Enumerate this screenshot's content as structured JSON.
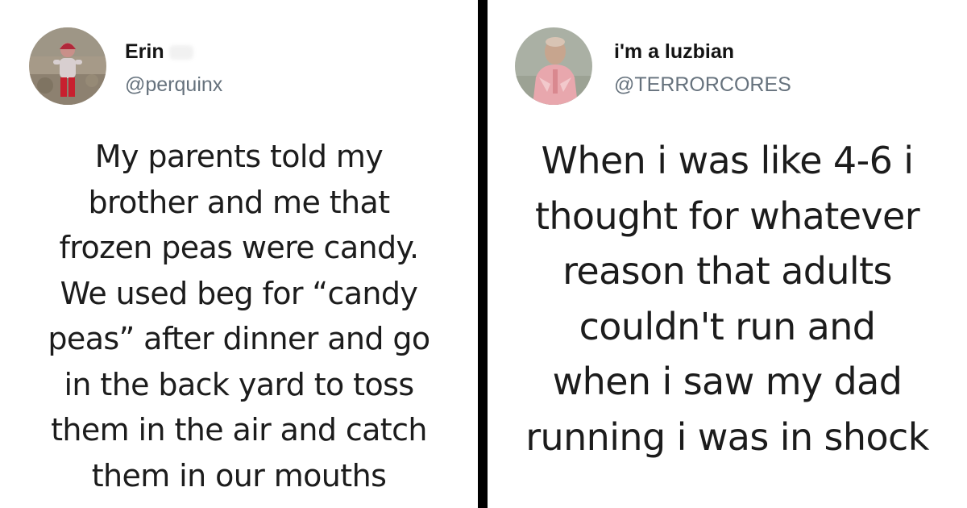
{
  "colors": {
    "divider": "#000000",
    "background": "#ffffff",
    "handle": "#66727d",
    "text": "#1c1c1c"
  },
  "left_tweet": {
    "display_name": "Erin",
    "handle": "@perquinx",
    "avatar_icon": "profile-photo-child-in-red",
    "text": "My parents told my\nbrother and me that\nfrozen peas were candy.\nWe used beg for “candy\npeas” after dinner and go\nin the back yard to toss\nthem in the air and catch\nthem in our mouths"
  },
  "right_tweet": {
    "display_name": "i'm a luzbian",
    "handle": "@TERRORCORES",
    "avatar_icon": "profile-photo-figure-in-pink",
    "text": "When i was like 4-6 i\nthought for whatever\nreason that adults\ncouldn't run and\nwhen i saw my dad\nrunning i was in shock"
  }
}
